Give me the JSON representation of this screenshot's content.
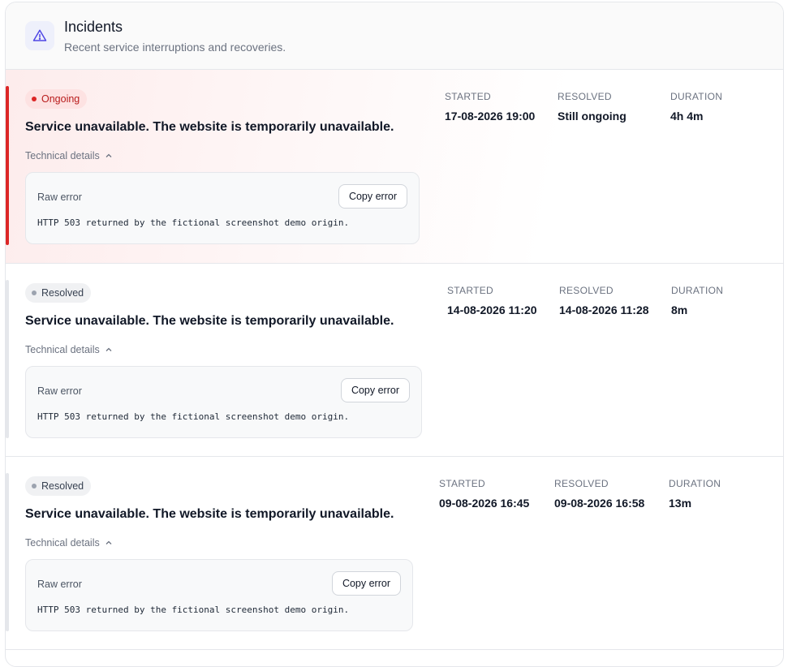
{
  "header": {
    "icon": "warning-triangle-icon",
    "title": "Incidents",
    "subtitle": "Recent service interruptions and recoveries."
  },
  "labels": {
    "started": "STARTED",
    "resolved": "RESOLVED",
    "duration": "DURATION",
    "technical_details": "Technical details",
    "raw_error": "Raw error",
    "copy_error": "Copy error"
  },
  "colors": {
    "ongoing_accent": "#dc2626",
    "resolved_accent": "#e5e7eb",
    "icon_accent": "#4f46e5"
  },
  "incidents": [
    {
      "status": "Ongoing",
      "title": "Service unavailable. The website is temporarily unavailable.",
      "started": "17-08-2026 19:00",
      "resolved": "Still ongoing",
      "duration": "4h 4m",
      "raw_error": "HTTP 503 returned by the fictional screenshot demo origin."
    },
    {
      "status": "Resolved",
      "title": "Service unavailable. The website is temporarily unavailable.",
      "started": "14-08-2026 11:20",
      "resolved": "14-08-2026 11:28",
      "duration": "8m",
      "raw_error": "HTTP 503 returned by the fictional screenshot demo origin."
    },
    {
      "status": "Resolved",
      "title": "Service unavailable. The website is temporarily unavailable.",
      "started": "09-08-2026 16:45",
      "resolved": "09-08-2026 16:58",
      "duration": "13m",
      "raw_error": "HTTP 503 returned by the fictional screenshot demo origin."
    }
  ]
}
